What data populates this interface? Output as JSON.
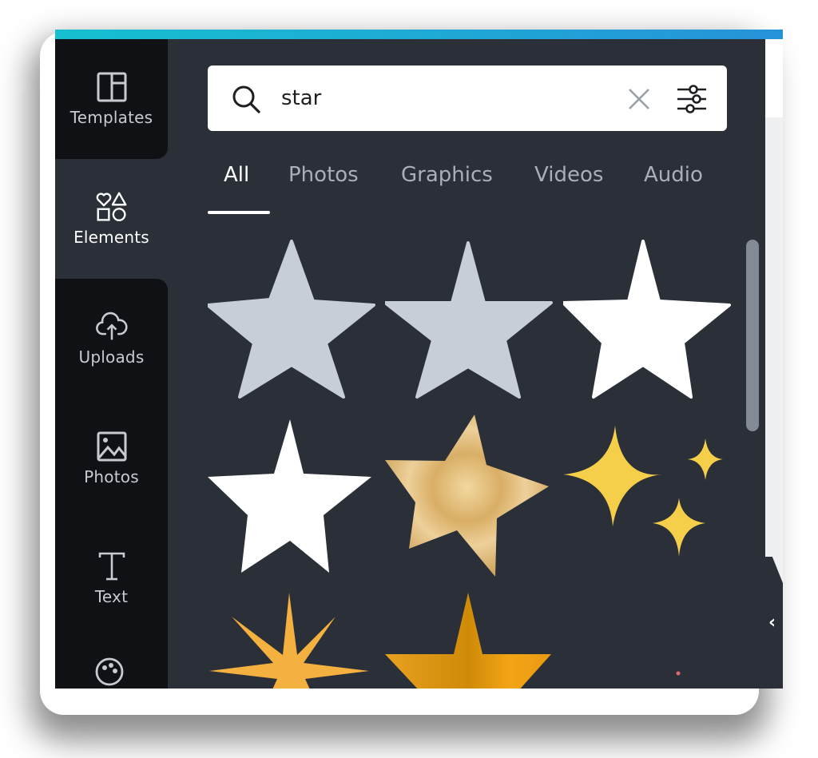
{
  "app": {
    "accent_gradient": [
      "#16c0cf",
      "#2692d8"
    ],
    "panel_color": "#2a2f38",
    "sidebar_color": "#0f1115"
  },
  "sidebar": {
    "items": [
      {
        "label": "Templates",
        "icon": "templates-icon",
        "active": false
      },
      {
        "label": "Elements",
        "icon": "elements-icon",
        "active": true
      },
      {
        "label": "Uploads",
        "icon": "cloud-upload-icon",
        "active": false
      },
      {
        "label": "Photos",
        "icon": "image-icon",
        "active": false
      },
      {
        "label": "Text",
        "icon": "text-icon",
        "active": false
      },
      {
        "label": "",
        "icon": "palette-icon",
        "active": false
      }
    ]
  },
  "search": {
    "value": "star",
    "placeholder": "",
    "search_icon": "search-icon",
    "clear_icon": "close-icon",
    "filter_icon": "sliders-icon"
  },
  "tabs": [
    {
      "label": "All",
      "active": true
    },
    {
      "label": "Photos",
      "active": false
    },
    {
      "label": "Graphics",
      "active": false
    },
    {
      "label": "Videos",
      "active": false
    },
    {
      "label": "Audio",
      "active": false
    }
  ],
  "results": [
    {
      "name": "gray-star",
      "color": "#c8ced7"
    },
    {
      "name": "gray-star",
      "color": "#c8ced7"
    },
    {
      "name": "white-star",
      "color": "#ffffff"
    },
    {
      "name": "white-star",
      "color": "#ffffff"
    },
    {
      "name": "gold-foil-star",
      "color": "#e0b870"
    },
    {
      "name": "yellow-sparkles",
      "color": "#f6cf4a"
    },
    {
      "name": "orange-burst-star",
      "color": "#f5b13f"
    },
    {
      "name": "gold-star",
      "color": "#e69a10"
    },
    {
      "name": "pink-dots",
      "color": "#e36a6a"
    }
  ],
  "collapse_button": {
    "icon": "chevron-left-icon",
    "glyph": "‹"
  }
}
